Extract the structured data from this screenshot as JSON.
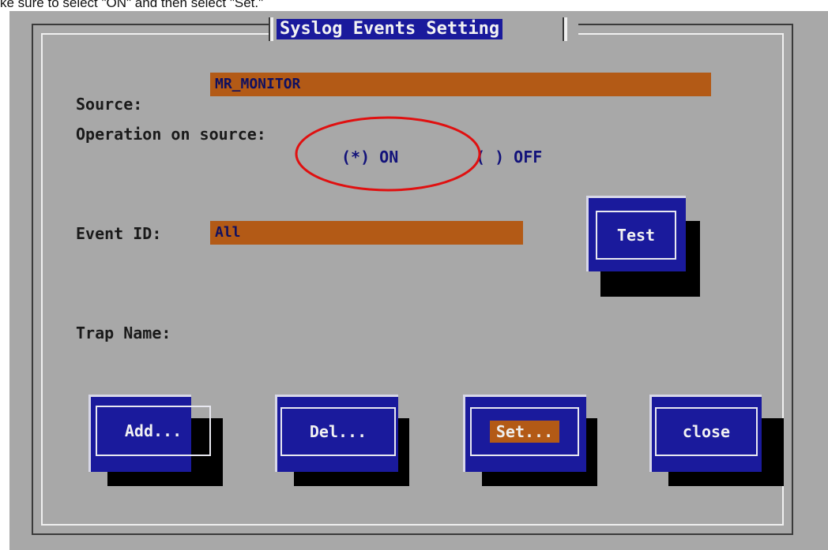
{
  "caption": "ke sure to select \"ON\" and then select \"Set.\"",
  "dialog": {
    "title": "Syslog Events Setting",
    "source": {
      "label": "Source:",
      "value": "MR_MONITOR"
    },
    "operation": {
      "label": "Operation on source:",
      "on_label": "(*) ON",
      "off_label": "( ) OFF",
      "selected": "ON"
    },
    "event_id": {
      "label": "Event ID:",
      "value": "All"
    },
    "trap_name": {
      "label": "Trap Name:"
    },
    "buttons": {
      "test": "Test",
      "add": "Add...",
      "del": "Del...",
      "set": "Set...",
      "close": "close"
    }
  },
  "annotation": {
    "shape": "ellipse",
    "target": "operation-on-radio",
    "color": "#e01010"
  },
  "colors": {
    "screen_bg": "#a8a8a8",
    "button_blue": "#1a1a9c",
    "field_orange": "#b35a16",
    "text_dark": "#1a1a1a",
    "radio_blue": "#12127a"
  }
}
